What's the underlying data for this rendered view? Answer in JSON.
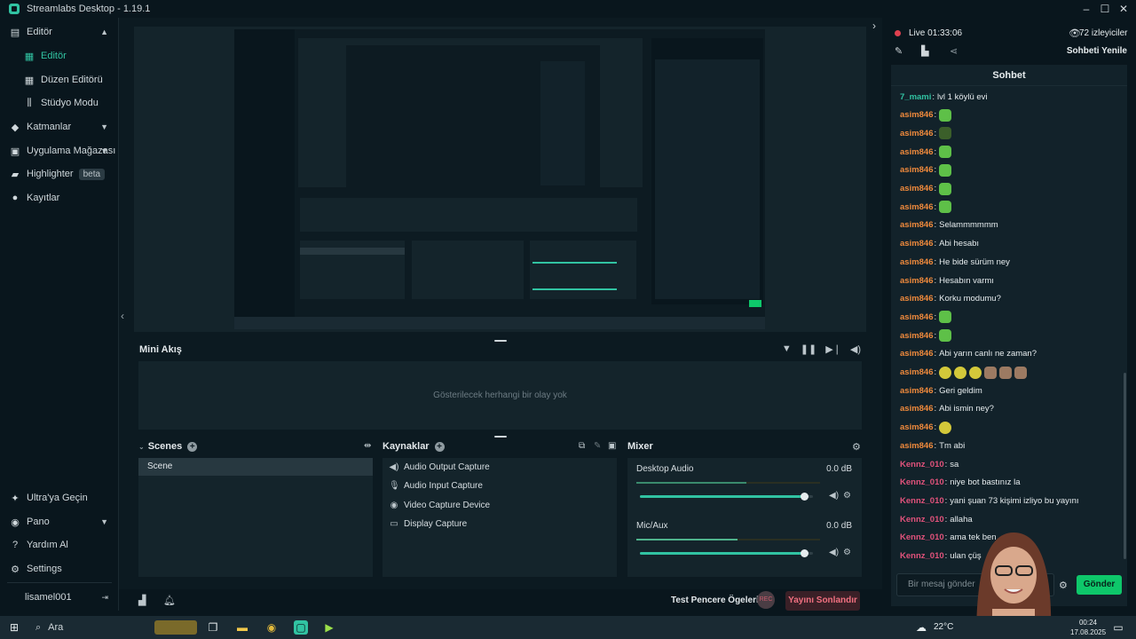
{
  "window": {
    "title": "Streamlabs Desktop - 1.19.1"
  },
  "sidebar": {
    "items": [
      {
        "label": "Editör",
        "icon": "editor-icon"
      },
      {
        "label": "Editör",
        "icon": "editor-icon",
        "active": true
      },
      {
        "label": "Düzen Editörü",
        "icon": "layout-icon"
      },
      {
        "label": "Stüdyo Modu",
        "icon": "studio-icon"
      },
      {
        "label": "Katmanlar",
        "icon": "layers-icon"
      },
      {
        "label": "Uygulama Mağazası",
        "icon": "store-icon"
      },
      {
        "label": "Highlighter",
        "icon": "highlighter-icon",
        "badge": "beta"
      },
      {
        "label": "Kayıtlar",
        "icon": "recordings-icon"
      }
    ],
    "bottom": [
      {
        "label": "Ultra'ya Geçin",
        "icon": "ultra-icon"
      },
      {
        "label": "Pano",
        "icon": "dashboard-icon"
      },
      {
        "label": "Yardım Al",
        "icon": "help-icon"
      },
      {
        "label": "Settings",
        "icon": "gear-icon"
      }
    ],
    "user": "lisamel001"
  },
  "mini_feed": {
    "title": "Mini Akış",
    "empty": "Gösterilecek herhangi bir olay yok"
  },
  "scenes": {
    "title": "Scenes",
    "items": [
      "Scene"
    ]
  },
  "sources": {
    "title": "Kaynaklar",
    "items": [
      "Audio Output Capture",
      "Audio Input Capture",
      "Video Capture Device",
      "Display Capture"
    ]
  },
  "mixer": {
    "title": "Mixer",
    "channels": [
      {
        "name": "Desktop Audio",
        "db": "0.0 dB",
        "volume": 0.95
      },
      {
        "name": "Mic/Aux",
        "db": "0.0 dB",
        "volume": 0.95
      }
    ]
  },
  "footer": {
    "test_label": "Test Pencere Ögeleri",
    "rec_label": "REC",
    "end_label": "Yayını Sonlandır"
  },
  "stream": {
    "live_label": "Live",
    "time": "01:33:06",
    "viewers": "72 izleyiciler",
    "refresh_label": "Sohbeti Yenile"
  },
  "chat": {
    "title": "Sohbet",
    "messages": [
      {
        "user": "7_mami",
        "text": "lvl 1 köylü evi",
        "color": "#31c3a2"
      },
      {
        "user": "asim846",
        "text": "",
        "color": "#f08a3c",
        "emote": "green"
      },
      {
        "user": "asim846",
        "text": "",
        "color": "#f08a3c",
        "emote": "dark"
      },
      {
        "user": "asim846",
        "text": "",
        "color": "#f08a3c",
        "emote": "green"
      },
      {
        "user": "asim846",
        "text": "",
        "color": "#f08a3c",
        "emote": "green"
      },
      {
        "user": "asim846",
        "text": "",
        "color": "#f08a3c",
        "emote": "green"
      },
      {
        "user": "asim846",
        "text": "",
        "color": "#f08a3c",
        "emote": "green"
      },
      {
        "user": "asim846",
        "text": "Selammmmmm",
        "color": "#f08a3c"
      },
      {
        "user": "asim846",
        "text": "Abi hesabı",
        "color": "#f08a3c"
      },
      {
        "user": "asim846",
        "text": "He bide sürüm ney",
        "color": "#f08a3c"
      },
      {
        "user": "asim846",
        "text": "Hesabın varmı",
        "color": "#f08a3c"
      },
      {
        "user": "asim846",
        "text": "Korku modumu?",
        "color": "#f08a3c"
      },
      {
        "user": "asim846",
        "text": "",
        "color": "#f08a3c",
        "emote": "green"
      },
      {
        "user": "asim846",
        "text": "",
        "color": "#f08a3c",
        "emote": "green"
      },
      {
        "user": "asim846",
        "text": "Abi yarın canlı ne zaman?",
        "color": "#f08a3c"
      },
      {
        "user": "asim846",
        "text": "",
        "color": "#f08a3c",
        "emote": "lemoncats"
      },
      {
        "user": "asim846",
        "text": "Geri geldim",
        "color": "#f08a3c"
      },
      {
        "user": "asim846",
        "text": "Abi ismin ney?",
        "color": "#f08a3c"
      },
      {
        "user": "asim846",
        "text": "",
        "color": "#f08a3c",
        "emote": "lemon"
      },
      {
        "user": "asim846",
        "text": "Tm abi",
        "color": "#f08a3c"
      },
      {
        "user": "Kennz_010",
        "text": "sa",
        "color": "#e0527b"
      },
      {
        "user": "Kennz_010",
        "text": "niye bot bastınız la",
        "color": "#e0527b"
      },
      {
        "user": "Kennz_010",
        "text": "yani şuan 73 kişimi izliyo bu yayını",
        "color": "#e0527b"
      },
      {
        "user": "Kennz_010",
        "text": "allaha",
        "color": "#e0527b"
      },
      {
        "user": "Kennz_010",
        "text": "ama tek ben",
        "color": "#e0527b"
      },
      {
        "user": "Kennz_010",
        "text": "ulan çüş",
        "color": "#e0527b"
      }
    ],
    "input_placeholder": "Bir mesaj gönder",
    "send_label": "Gönder"
  },
  "taskbar": {
    "search": "Ara",
    "weather": "22°C",
    "time": "00:24",
    "date": "17.08.2025"
  }
}
